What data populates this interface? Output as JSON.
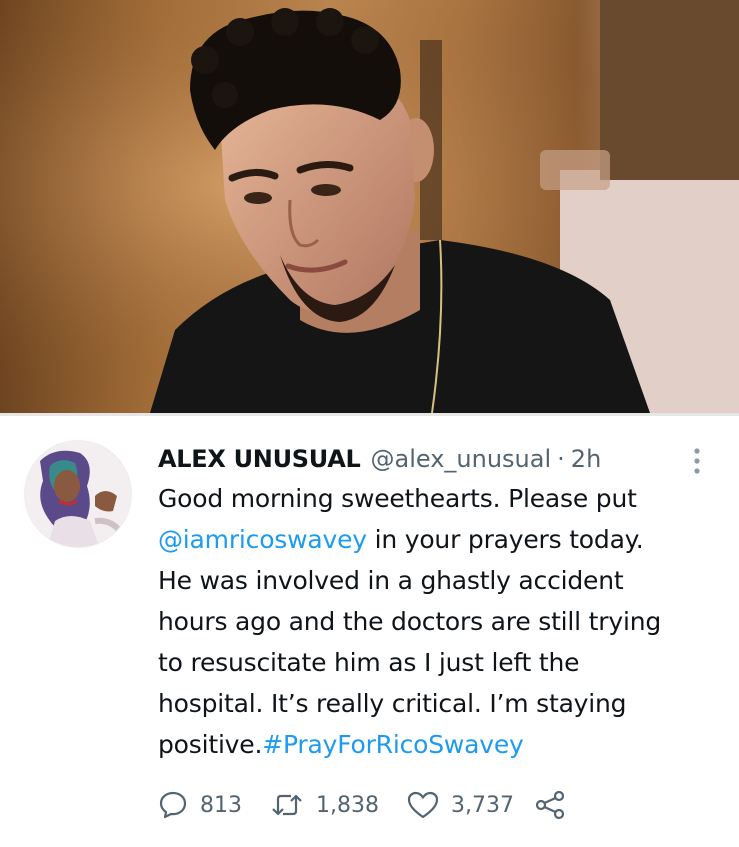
{
  "tweet": {
    "author_name": "ALEX UNUSUAL",
    "handle": "@alex_unusual",
    "separator": "·",
    "time": "2h",
    "body_lines": [
      [
        {
          "text": "Good morning sweethearts. Please put",
          "link": false
        }
      ],
      [
        {
          "text": "@iamricoswavey",
          "link": true
        },
        {
          "text": " in your prayers today.",
          "link": false
        }
      ],
      [
        {
          "text": "He was involved in a ghastly accident",
          "link": false
        }
      ],
      [
        {
          "text": "hours ago and the doctors are still trying",
          "link": false
        }
      ],
      [
        {
          "text": "to resuscitate him as I just left the",
          "link": false
        }
      ],
      [
        {
          "text": "hospital. It’s really critical. I’m staying",
          "link": false
        }
      ],
      [
        {
          "text": "positive.",
          "link": false
        },
        {
          "text": "#PrayForRicoSwavey",
          "link": true
        }
      ]
    ],
    "replies": "813",
    "retweets": "1,838",
    "likes": "3,737"
  },
  "icons": {
    "reply": "speech-bubble-icon",
    "retweet": "retweet-arrows-icon",
    "like": "heart-icon",
    "share": "share-nodes-icon",
    "more": "vertical-ellipsis-icon"
  },
  "colors": {
    "link": "#1d9bf0",
    "secondary_text": "#536471",
    "primary_text": "#0f1419"
  }
}
